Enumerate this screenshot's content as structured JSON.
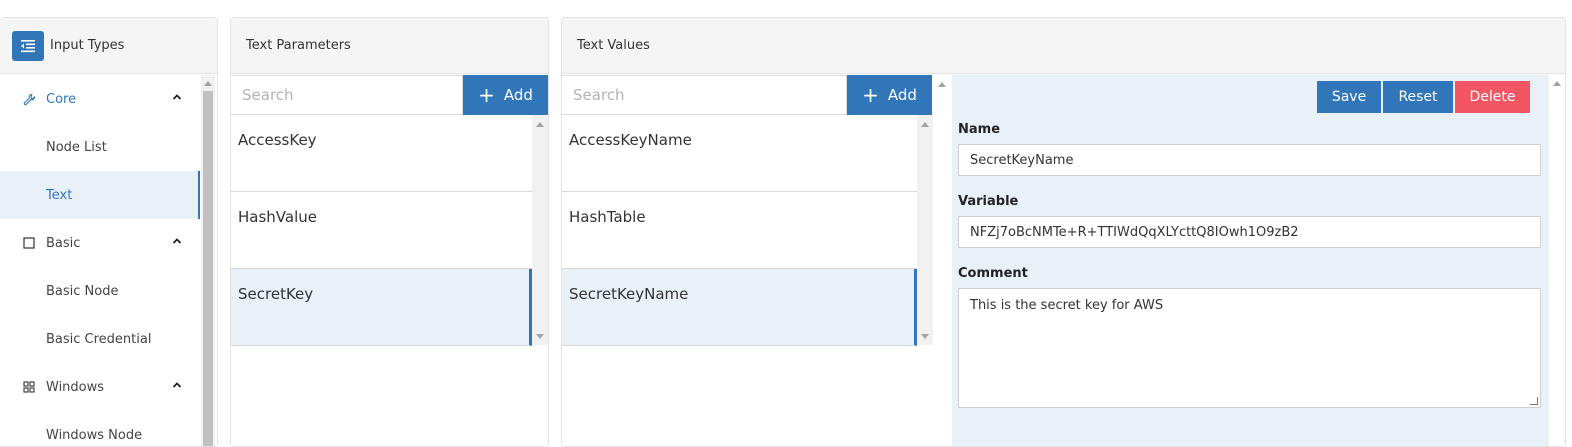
{
  "sidebar": {
    "title": "Input Types",
    "sections": [
      {
        "label": "Core",
        "icon": "wrench-icon",
        "items": [
          "Node List",
          "Text"
        ]
      },
      {
        "label": "Basic",
        "icon": "square-icon",
        "items": [
          "Basic Node",
          "Basic Credential"
        ]
      },
      {
        "label": "Windows",
        "icon": "windows-icon",
        "items": [
          "Windows Node"
        ]
      }
    ],
    "active_item": "Text"
  },
  "text_parameters": {
    "title": "Text Parameters",
    "search_placeholder": "Search",
    "add_label": "Add",
    "items": [
      "AccessKey",
      "HashValue",
      "SecretKey"
    ],
    "selected": "SecretKey"
  },
  "text_values": {
    "title": "Text Values",
    "search_placeholder": "Search",
    "add_label": "Add",
    "items": [
      "AccessKeyName",
      "HashTable",
      "SecretKeyName"
    ],
    "selected": "SecretKeyName"
  },
  "editor": {
    "save_label": "Save",
    "reset_label": "Reset",
    "delete_label": "Delete",
    "name_label": "Name",
    "name_value": "SecretKeyName",
    "variable_label": "Variable",
    "variable_value": "NFZj7oBcNMTe+R+TTIWdQqXLYcttQ8IOwh1O9zB2",
    "comment_label": "Comment",
    "comment_value": "This is the secret key for AWS"
  },
  "colors": {
    "accent": "#3076b9",
    "danger": "#f25563",
    "selected_bg": "#e8f0f8"
  }
}
